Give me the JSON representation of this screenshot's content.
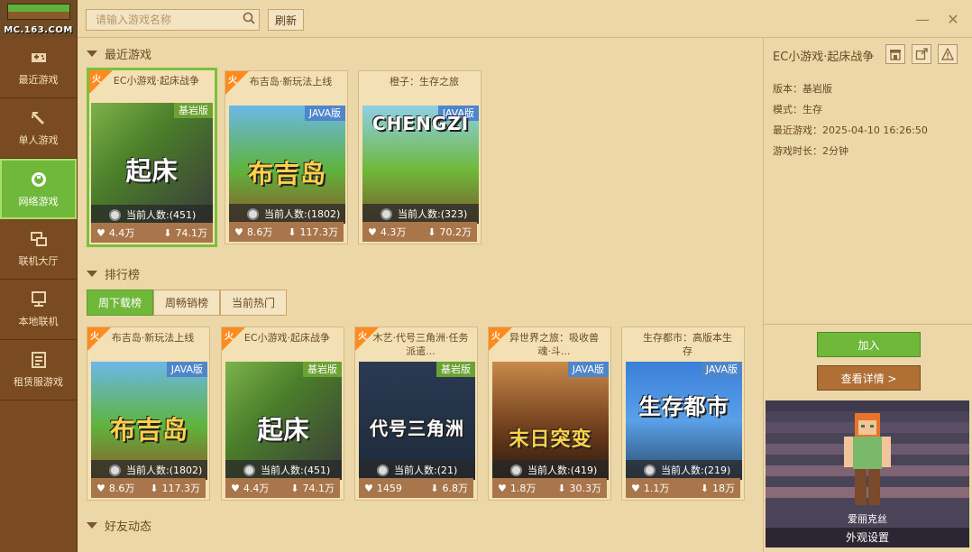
{
  "logo": {
    "text": "MC.163.COM"
  },
  "sidebar": {
    "items": [
      {
        "label": "最近游戏"
      },
      {
        "label": "单人游戏"
      },
      {
        "label": "网络游戏"
      },
      {
        "label": "联机大厅"
      },
      {
        "label": "本地联机"
      },
      {
        "label": "租赁服游戏"
      }
    ]
  },
  "search": {
    "placeholder": "请输入游戏名称"
  },
  "toolbar": {
    "refresh_label": "刷新",
    "minimize": "—",
    "close": "✕"
  },
  "recent": {
    "title": "最近游戏",
    "cards": [
      {
        "fire": "火",
        "title": "EC小游戏·起床战争",
        "tag": "基岩版",
        "art": "起床",
        "online": "当前人数:(451)",
        "likes": "4.4万",
        "downloads": "74.1万"
      },
      {
        "fire": "火",
        "title": "布吉岛·新玩法上线",
        "tag": "JAVA版",
        "art": "布吉岛",
        "online": "当前人数:(1802)",
        "likes": "8.6万",
        "downloads": "117.3万"
      },
      {
        "fire": "",
        "title": "橙子：生存之旅",
        "tag": "JAVA版",
        "art": "CHENGZI",
        "online": "当前人数:(323)",
        "likes": "4.3万",
        "downloads": "70.2万"
      }
    ]
  },
  "ranking": {
    "title": "排行榜",
    "tabs": [
      {
        "label": "周下载榜"
      },
      {
        "label": "周畅销榜"
      },
      {
        "label": "当前热门"
      }
    ],
    "cards": [
      {
        "fire": "火",
        "title": "布吉岛·新玩法上线",
        "tag": "JAVA版",
        "art": "布吉岛",
        "online": "当前人数:(1802)",
        "likes": "8.6万",
        "downloads": "117.3万"
      },
      {
        "fire": "火",
        "title": "EC小游戏·起床战争",
        "tag": "基岩版",
        "art": "起床",
        "online": "当前人数:(451)",
        "likes": "4.4万",
        "downloads": "74.1万"
      },
      {
        "fire": "火",
        "title": "木艺·代号三角洲·任务派遣...",
        "tag": "基岩版",
        "art": "代号三角洲",
        "online": "当前人数:(21)",
        "likes": "1459",
        "downloads": "6.8万"
      },
      {
        "fire": "火",
        "title": "异世界之旅：吸收兽魂·斗...",
        "tag": "JAVA版",
        "art": "末日突变",
        "online": "当前人数:(419)",
        "likes": "1.8万",
        "downloads": "30.3万"
      },
      {
        "fire": "",
        "title": "生存都市：高版本生存",
        "tag": "JAVA版",
        "art": "生存都市",
        "online": "当前人数:(219)",
        "likes": "1.1万",
        "downloads": "18万"
      }
    ]
  },
  "friends": {
    "title": "好友动态"
  },
  "detail": {
    "title": "EC小游戏·起床战争",
    "version": "版本：基岩版",
    "mode": "模式：生存",
    "last_played": "最近游戏：2025-04-10 16:26:50",
    "duration": "游戏时长：2分钟",
    "join_label": "加入",
    "detail_label": "查看详情 >"
  },
  "skin": {
    "name": "爱丽克丝",
    "button_label": "外观设置"
  },
  "colors": {
    "accent_green": "#6fb83a",
    "sidebar_brown": "#7a4a22",
    "panel_beige": "#ecd7a8",
    "fire_orange": "#ff8a1e"
  }
}
